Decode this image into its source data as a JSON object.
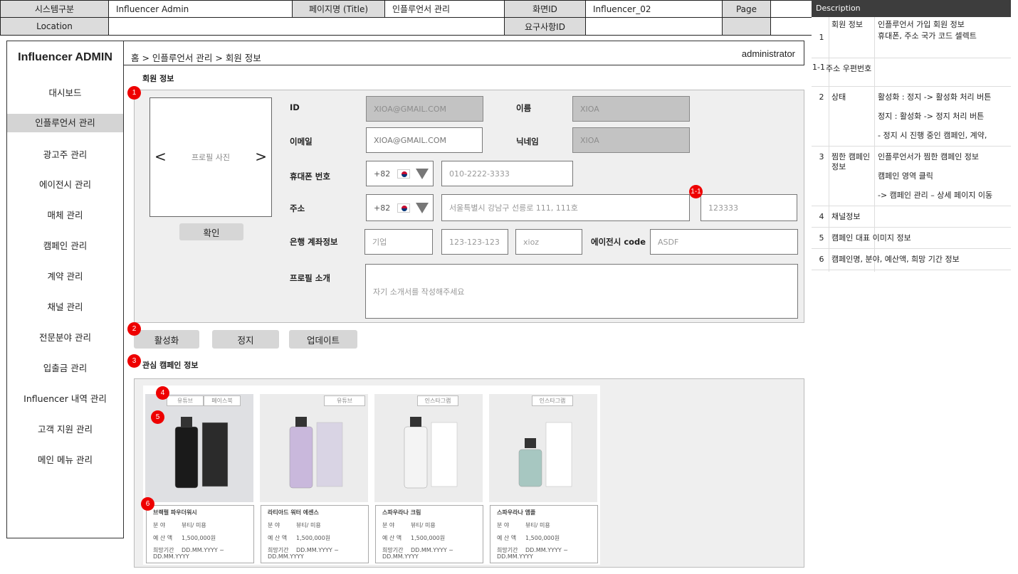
{
  "header": {
    "system_label": "시스템구분",
    "system_value": "Influencer Admin",
    "page_title_label": "페이지명 (Title)",
    "page_title_value": "인플루언서 관리",
    "screen_id_label": "화면ID",
    "screen_id_value": "Influencer_02",
    "page_label": "Page",
    "location_label": "Location",
    "requirement_id_label": "요구사항ID"
  },
  "description": {
    "title": "Description",
    "rows": [
      {
        "num": "1",
        "title": "회원 정보",
        "lines": [
          "인플루언서 가입 회원 정보",
          "휴대폰, 주소 국가 코드 셀렉트"
        ]
      },
      {
        "num": "1-1",
        "title": "주소 우편번호",
        "lines": []
      },
      {
        "num": "2",
        "title": "상태",
        "lines": [
          "활성화 : 정지 -> 활성화 처리 버튼",
          "정지 : 활성화 -> 정지 처리 버튼",
          "-    정지 시 진행 중인 캠페인, 계약,"
        ]
      },
      {
        "num": "3",
        "title": "찜한 캠페인 정보",
        "lines": [
          "인플루언서가 찜한 캠페인 정보",
          "캠페인 영역 클릭",
          "-> 캠페인 관리 – 상세 페이지 이동"
        ]
      },
      {
        "num": "4",
        "title": "채널정보",
        "lines": []
      },
      {
        "num": "5",
        "title": "캠페인 대표 이미지 정보",
        "lines": []
      },
      {
        "num": "6",
        "title": "캠페인명, 분야, 예산액, 희망 기간 정보",
        "lines": []
      }
    ]
  },
  "sidebar": {
    "brand": "Influencer ADMIN",
    "items": [
      "대시보드",
      "인플루언서 관리",
      "광고주 관리",
      "에이전시 관리",
      "매체 관리",
      "캠페인 관리",
      "계약 관리",
      "채널 관리",
      "전문분야 관리",
      "입출금 관리",
      "Influencer 내역 관리",
      "고객 지원 관리",
      "메인 메뉴 관리"
    ],
    "active_index": 1
  },
  "breadcrumb": "홈 > 인플루언서 관리 > 회원 정보",
  "user": "administrator",
  "member": {
    "section_title": "회원 정보",
    "photo_label": "프로필 사진",
    "confirm_button": "확인",
    "id_label": "ID",
    "id_value": "XIOA@GMAIL.COM",
    "name_label": "이름",
    "name_value": "XIOA",
    "email_label": "이메일",
    "email_value": "XIOA@GMAIL.COM",
    "nickname_label": "닉네임",
    "nickname_value": "XIOA",
    "phone_label": "휴대폰 번호",
    "phone_code": "+82",
    "phone_value": "010-2222-3333",
    "address_label": "주소",
    "address_code": "+82",
    "address_value": "서울특별시 강남구 선릉로 111, 111호",
    "postcode_value": "123333",
    "bank_label": "은행 계좌정보",
    "bank_name": "기업",
    "bank_account": "123-123-123",
    "bank_holder": "xioz",
    "agency_label": "에이전시 code",
    "agency_value": "ASDF",
    "intro_label": "프로필 소개",
    "intro_placeholder": "자기 소개서를 작성해주세요"
  },
  "status_buttons": {
    "activate": "활성화",
    "suspend": "정지",
    "update": "업데이트"
  },
  "campaign": {
    "section_title": "관심 캠페인 정보",
    "cards": [
      {
        "tags": [
          "유튜브",
          "페이스북"
        ],
        "name": "브랙펄 파우더워시",
        "field_label": "분 야",
        "field": "뷰티/ 미용",
        "budget_label": "예 산 액",
        "budget": "1,500,000원",
        "period_label": "희망기간",
        "period": "DD.MM.YYYY ~ DD.MM.YYYY",
        "bottle": "#1a1a1a",
        "box": "#2b2b2b"
      },
      {
        "tags": [
          "유튜브"
        ],
        "name": "라티아드 워터 에센스",
        "field_label": "분 야",
        "field": "뷰티/ 미용",
        "budget_label": "예 산 액",
        "budget": "1,500,000원",
        "period_label": "희망기간",
        "period": "DD.MM.YYYY ~ DD.MM.YYYY",
        "bottle": "#c9b8dc",
        "box": "#d9d4e4"
      },
      {
        "tags": [
          "인스타그램"
        ],
        "name": "스파우라나 크림",
        "field_label": "분 야",
        "field": "뷰티/ 미용",
        "budget_label": "예 산 액",
        "budget": "1,500,000원",
        "period_label": "희망기간",
        "period": "DD.MM.YYYY ~ DD.MM.YYYY",
        "bottle": "#f4f4f4",
        "box": "#ffffff"
      },
      {
        "tags": [
          "인스타그램"
        ],
        "name": "스파우라나 앰플",
        "field_label": "분 야",
        "field": "뷰티/ 미용",
        "budget_label": "예 산 액",
        "budget": "1,500,000원",
        "period_label": "희망기간",
        "period": "DD.MM.YYYY ~ DD.MM.YYYY",
        "bottle": "#a7c7c1",
        "box": "#ffffff"
      }
    ]
  },
  "badges": [
    "1",
    "1-1",
    "2",
    "3",
    "4",
    "5",
    "6"
  ]
}
